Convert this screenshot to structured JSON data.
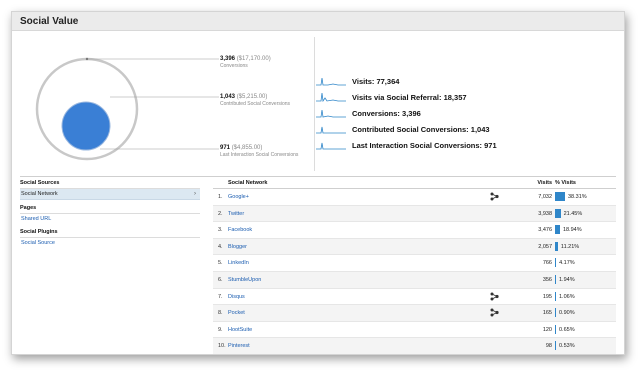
{
  "page": {
    "title": "Social Value"
  },
  "conversions": [
    {
      "value": "3,396",
      "amount": "($17,170.00)",
      "label": "Conversions"
    },
    {
      "value": "1,043",
      "amount": "($5,215.00)",
      "label": "Contributed Social Conversions"
    },
    {
      "value": "971",
      "amount": "($4,855.00)",
      "label": "Last Interaction Social Conversions"
    }
  ],
  "metrics": [
    {
      "label": "Visits:",
      "value": "77,364"
    },
    {
      "label": "Visits via Social Referral:",
      "value": "18,357"
    },
    {
      "label": "Conversions:",
      "value": "3,396"
    },
    {
      "label": "Contributed Social Conversions:",
      "value": "1,043"
    },
    {
      "label": "Last Interaction Social Conversions:",
      "value": "971"
    }
  ],
  "sidebar": {
    "social_sources": {
      "heading": "Social Sources",
      "items": [
        {
          "label": "Social Network",
          "selected": true
        }
      ]
    },
    "pages": {
      "heading": "Pages",
      "items": [
        {
          "label": "Shared URL"
        }
      ]
    },
    "social_plugins": {
      "heading": "Social Plugins",
      "items": [
        {
          "label": "Social Source"
        }
      ]
    }
  },
  "table": {
    "columns": {
      "network": "Social Network",
      "visits": "Visits",
      "pct": "% Visits"
    },
    "rows": [
      {
        "rank": "1.",
        "name": "Google+",
        "hub": true,
        "visits": "7,032",
        "pct": "38.31%",
        "share": 38.31
      },
      {
        "rank": "2.",
        "name": "Twitter",
        "hub": false,
        "visits": "3,938",
        "pct": "21.45%",
        "share": 21.45
      },
      {
        "rank": "3.",
        "name": "Facebook",
        "hub": false,
        "visits": "3,476",
        "pct": "18.94%",
        "share": 18.94
      },
      {
        "rank": "4.",
        "name": "Blogger",
        "hub": false,
        "visits": "2,057",
        "pct": "11.21%",
        "share": 11.21
      },
      {
        "rank": "5.",
        "name": "LinkedIn",
        "hub": false,
        "visits": "766",
        "pct": "4.17%",
        "share": 4.17
      },
      {
        "rank": "6.",
        "name": "StumbleUpon",
        "hub": false,
        "visits": "356",
        "pct": "1.94%",
        "share": 1.94
      },
      {
        "rank": "7.",
        "name": "Disqus",
        "hub": true,
        "visits": "195",
        "pct": "1.06%",
        "share": 1.06
      },
      {
        "rank": "8.",
        "name": "Pocket",
        "hub": true,
        "visits": "165",
        "pct": "0.90%",
        "share": 0.9
      },
      {
        "rank": "9.",
        "name": "HootSuite",
        "hub": false,
        "visits": "120",
        "pct": "0.65%",
        "share": 0.65
      },
      {
        "rank": "10.",
        "name": "Pinterest",
        "hub": false,
        "visits": "98",
        "pct": "0.53%",
        "share": 0.53
      }
    ]
  },
  "colors": {
    "accent": "#2f86c9",
    "link": "#1a5cb0",
    "circle_fill": "#3a7fd5",
    "ring": "#c8c8c8"
  },
  "icons": {
    "hub": "activity-stream-icon",
    "chevron": "chevron-right-icon",
    "sparkline": "sparkline-icon"
  }
}
